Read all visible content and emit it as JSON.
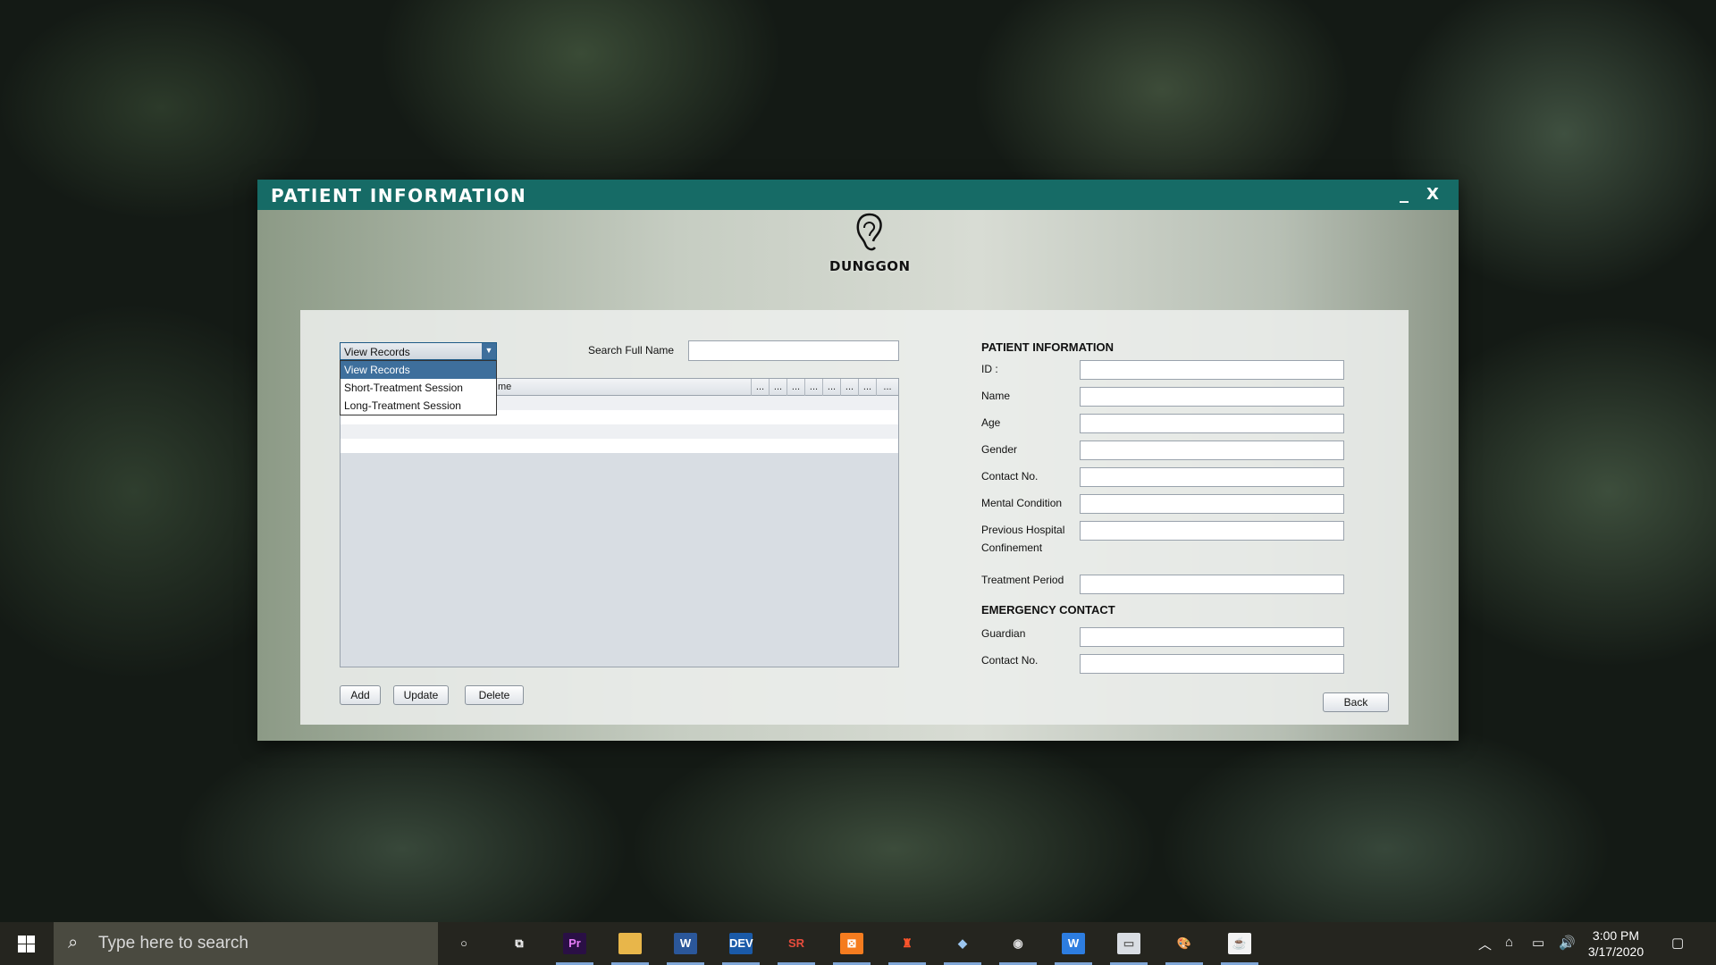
{
  "window": {
    "title": "PATIENT INFORMATION",
    "minimize": "_",
    "close": "X",
    "logo_text": "DUNGGON"
  },
  "records": {
    "combo_selected": "View Records",
    "dropdown_options": [
      "View Records",
      "Short-Treatment Session",
      "Long-Treatment Session"
    ],
    "search_label": "Search Full Name",
    "search_value": "",
    "table_headers": [
      "me",
      "...",
      "...",
      "...",
      "...",
      "...",
      "...",
      "...",
      "..."
    ],
    "buttons": {
      "add": "Add",
      "update": "Update",
      "delete": "Delete"
    }
  },
  "patient_form": {
    "heading": "PATIENT INFORMATION",
    "fields": {
      "id": "ID :",
      "name": "Name",
      "age": "Age",
      "gender": "Gender",
      "contact": "Contact No.",
      "mental": "Mental Condition",
      "prev_line1": "Previous Hospital",
      "prev_line2": "Confinement",
      "treatment": "Treatment Period"
    },
    "emergency_heading": "EMERGENCY CONTACT",
    "emergency": {
      "guardian": "Guardian",
      "contact": "Contact No."
    },
    "back": "Back"
  },
  "taskbar": {
    "search_placeholder": "Type here to search",
    "time": "3:00 PM",
    "date": "3/17/2020",
    "apps": [
      {
        "name": "cortana-icon",
        "glyph": "○"
      },
      {
        "name": "task-view-icon",
        "glyph": "⧉"
      },
      {
        "name": "premiere-pro-icon",
        "glyph": "Pr",
        "color": "#2a0f45",
        "fg": "#e77cf9"
      },
      {
        "name": "file-explorer-icon",
        "glyph": "▬",
        "color": "#e8b64a",
        "fg": "#e8b64a"
      },
      {
        "name": "word-icon",
        "glyph": "W",
        "color": "#2b579a",
        "fg": "#ffffff"
      },
      {
        "name": "dev-cpp-icon",
        "glyph": "DEV",
        "color": "#1a5aa8",
        "fg": "#ffffff"
      },
      {
        "name": "sr-app-icon",
        "glyph": "SR",
        "color": "transparent",
        "fg": "#e74c3c"
      },
      {
        "name": "xampp-icon",
        "glyph": "⊠",
        "color": "#f57c1f",
        "fg": "#ffffff"
      },
      {
        "name": "brave-icon",
        "glyph": "♜",
        "color": "transparent",
        "fg": "#fb542b"
      },
      {
        "name": "virtualbox-icon",
        "glyph": "◆",
        "color": "transparent",
        "fg": "#9cc6f0"
      },
      {
        "name": "media-player-icon",
        "glyph": "◉",
        "color": "transparent",
        "fg": "#ddd"
      },
      {
        "name": "wps-writer-icon",
        "glyph": "W",
        "color": "#2d7de0",
        "fg": "#ffffff"
      },
      {
        "name": "paint-window-icon",
        "glyph": "▭",
        "color": "#d9dde3",
        "fg": "#666"
      },
      {
        "name": "paint-icon",
        "glyph": "🎨",
        "color": "transparent",
        "fg": "#eee"
      },
      {
        "name": "java-icon",
        "glyph": "☕",
        "color": "#f2f2f2",
        "fg": "#e76f00"
      }
    ]
  }
}
